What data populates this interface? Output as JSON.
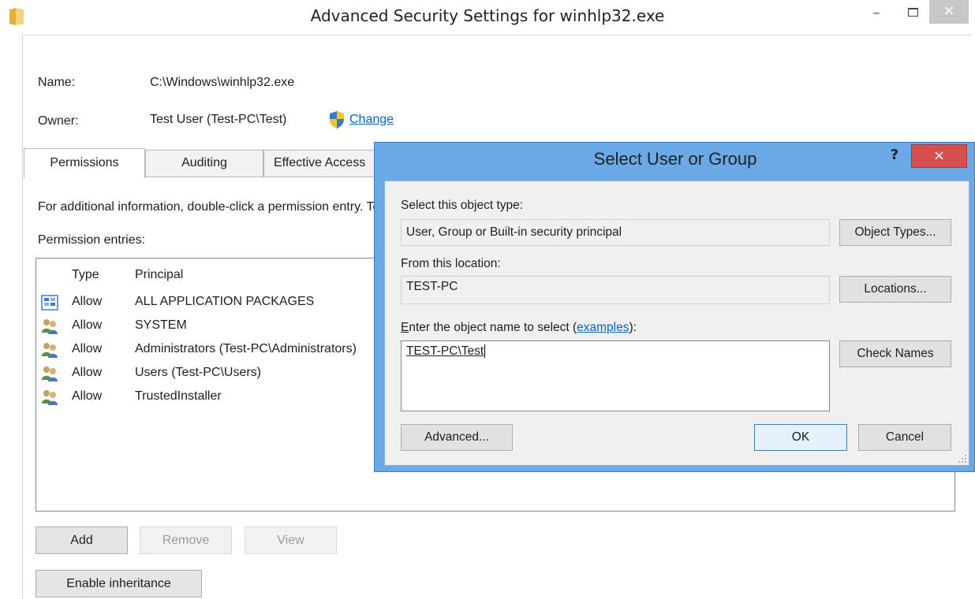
{
  "window": {
    "title": "Advanced Security Settings for winhlp32.exe",
    "minimize_glyph": "–",
    "close_glyph": "×"
  },
  "info": {
    "name_label": "Name:",
    "name_value": "C:\\Windows\\winhlp32.exe",
    "owner_label": "Owner:",
    "owner_value": "Test User (Test-PC\\Test)",
    "change_link": "Change"
  },
  "tabs": [
    {
      "label": "Permissions",
      "active": true
    },
    {
      "label": "Auditing",
      "active": false
    },
    {
      "label": "Effective Access",
      "active": false
    }
  ],
  "main": {
    "info_text": "For additional information, double-click a permission entry. To modify a permission entry, select the entry and click Edit (if available).",
    "entries_label": "Permission entries:",
    "columns": {
      "type": "Type",
      "principal": "Principal"
    },
    "rows": [
      {
        "type": "Allow",
        "principal": "ALL APPLICATION PACKAGES",
        "icon": "app-packages-icon"
      },
      {
        "type": "Allow",
        "principal": "SYSTEM",
        "icon": "user-group-icon"
      },
      {
        "type": "Allow",
        "principal": "Administrators (Test-PC\\Administrators)",
        "icon": "user-group-icon"
      },
      {
        "type": "Allow",
        "principal": "Users (Test-PC\\Users)",
        "icon": "user-group-icon"
      },
      {
        "type": "Allow",
        "principal": "TrustedInstaller",
        "icon": "user-group-icon"
      }
    ],
    "buttons": {
      "add": "Add",
      "remove": "Remove",
      "view": "View",
      "enable_inheritance": "Enable inheritance"
    }
  },
  "dialog": {
    "title": "Select User or Group",
    "help_glyph": "?",
    "close_glyph": "×",
    "object_type_label": "Select this object type:",
    "object_type_value": "User, Group or Built-in security principal",
    "object_types_button": "Object Types...",
    "location_label": "From this location:",
    "location_value": "TEST-PC",
    "locations_button": "Locations...",
    "enter_name_label_first": "E",
    "enter_name_label_rest": "nter the object name to select (",
    "examples_link": "examples",
    "enter_name_label_end": "):",
    "object_name_value": "TEST-PC\\Test",
    "check_names_button": "Check Names",
    "advanced_button": "Advanced...",
    "ok_button": "OK",
    "cancel_button": "Cancel"
  },
  "colors": {
    "dialog_frame": "#6aa9e6",
    "close_red": "#d75050",
    "link_blue": "#0066cc"
  }
}
